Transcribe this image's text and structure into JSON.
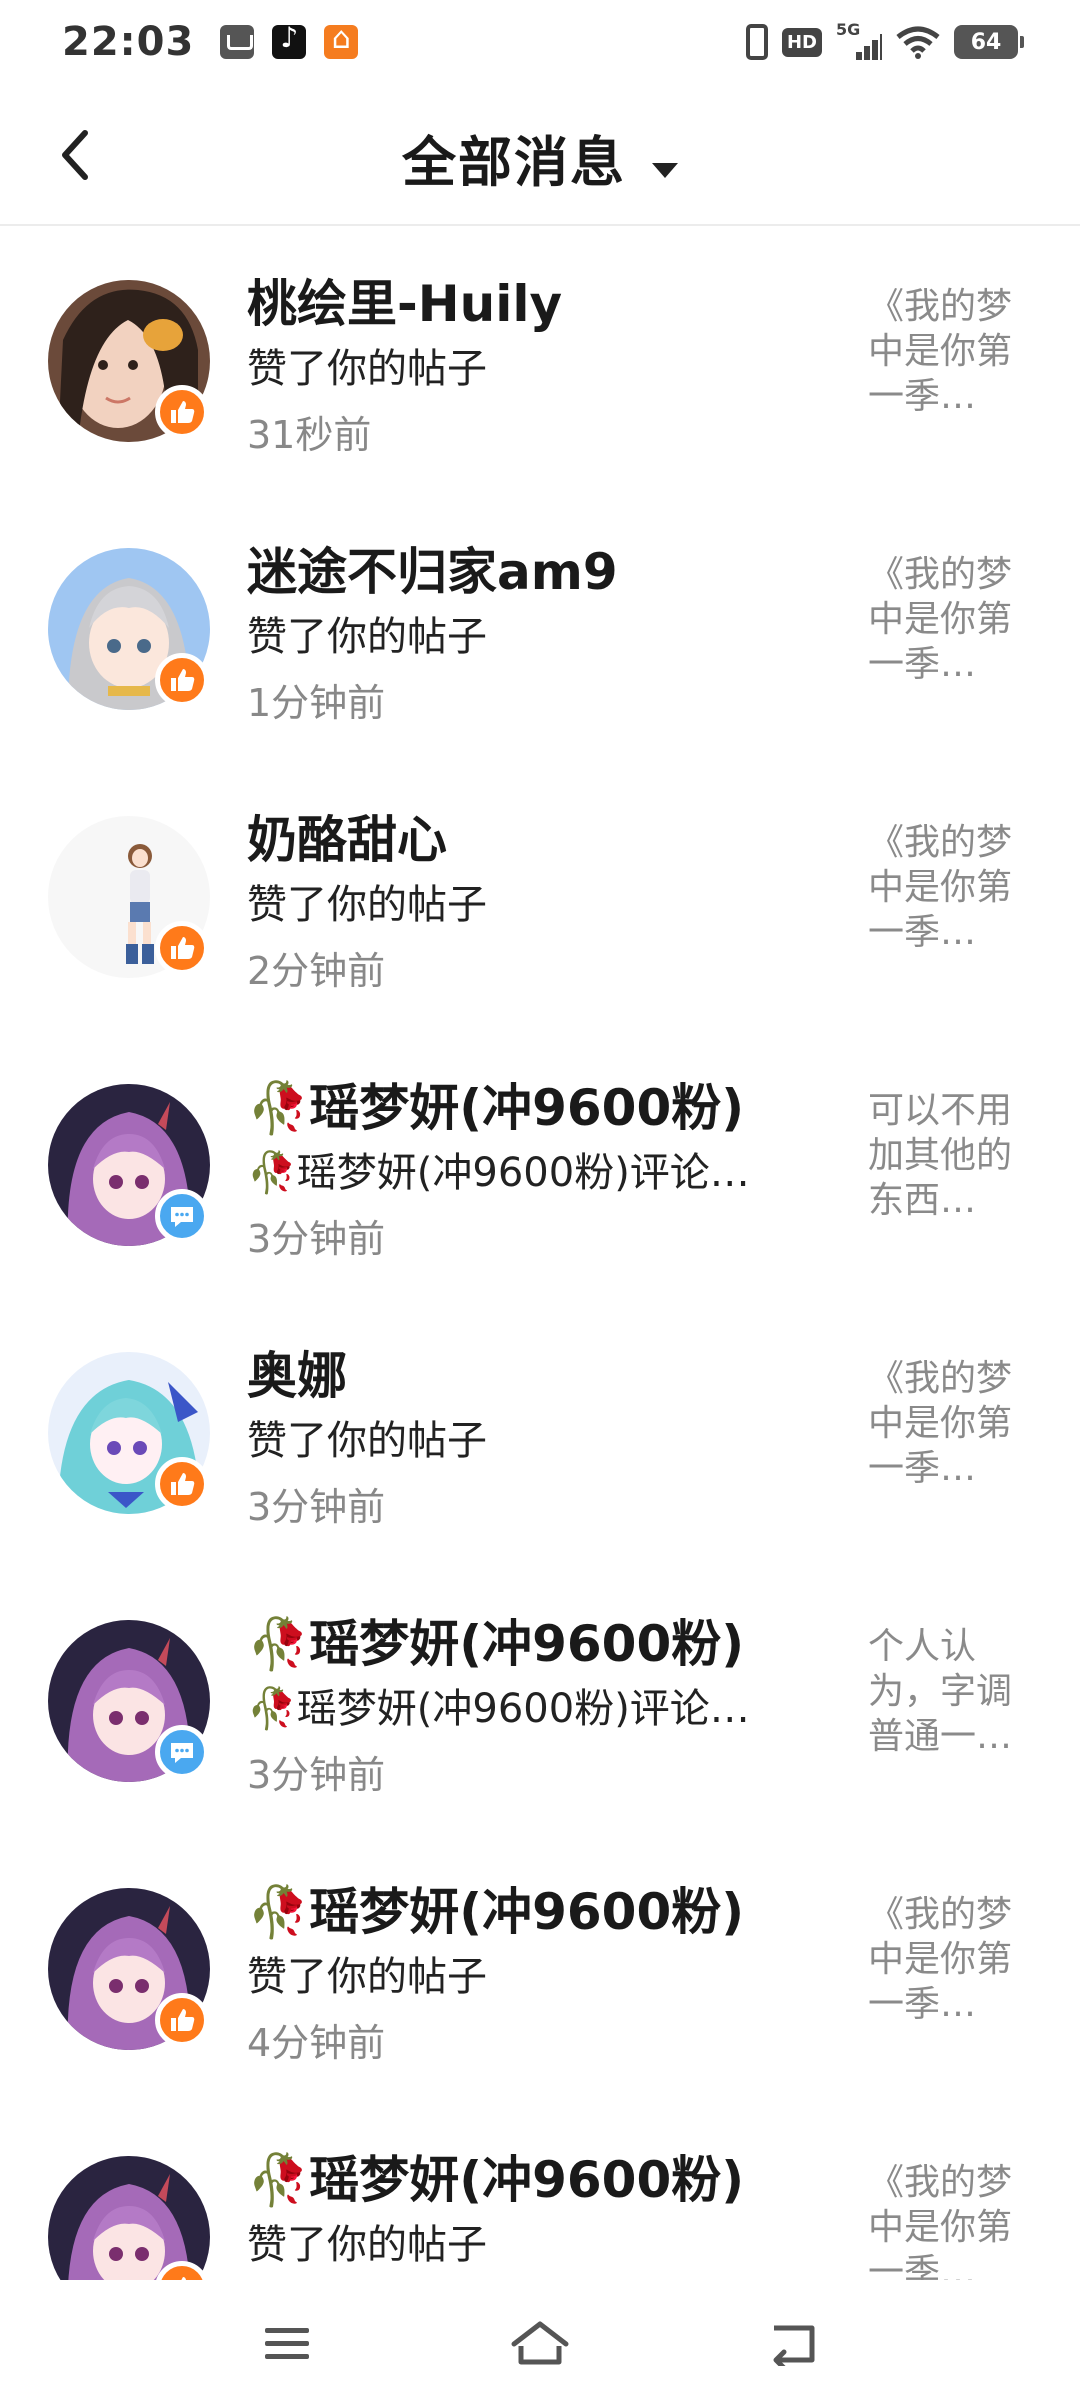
{
  "status_bar": {
    "time": "22:03",
    "network": "5G",
    "hd": "HD",
    "battery": "64"
  },
  "header": {
    "title": "全部消息"
  },
  "messages": [
    {
      "name": "桃绘里-Huily",
      "action": "赞了你的帖子",
      "time": "31秒前",
      "preview": "《我的梦中是你第一季…",
      "type": "like"
    },
    {
      "name": "迷途不归家am9",
      "action": "赞了你的帖子",
      "time": "1分钟前",
      "preview": "《我的梦中是你第一季…",
      "type": "like"
    },
    {
      "name": "奶酪甜心",
      "action": "赞了你的帖子",
      "time": "2分钟前",
      "preview": "《我的梦中是你第一季…",
      "type": "like"
    },
    {
      "name": "🥀瑶梦妍(冲9600粉)",
      "action": "🥀瑶梦妍(冲9600粉)评论…",
      "time": "3分钟前",
      "preview": "可以不用加其他的东西…",
      "type": "comment"
    },
    {
      "name": "奥娜",
      "action": "赞了你的帖子",
      "time": "3分钟前",
      "preview": "《我的梦中是你第一季…",
      "type": "like"
    },
    {
      "name": "🥀瑶梦妍(冲9600粉)",
      "action": "🥀瑶梦妍(冲9600粉)评论…",
      "time": "3分钟前",
      "preview": "个人认为，字调普通一…",
      "type": "comment"
    },
    {
      "name": "🥀瑶梦妍(冲9600粉)",
      "action": "赞了你的帖子",
      "time": "4分钟前",
      "preview": "《我的梦中是你第一季…",
      "type": "like"
    },
    {
      "name": "🥀瑶梦妍(冲9600粉)",
      "action": "赞了你的帖子",
      "time": "",
      "preview": "《我的梦中是你第一季…",
      "type": "like"
    }
  ],
  "icons": {
    "back": "back-arrow-icon",
    "dropdown": "caret-down-icon",
    "like_badge": "thumbs-up-icon",
    "comment_badge": "chat-bubble-icon",
    "nav_menu": "menu-icon",
    "nav_home": "home-icon",
    "nav_back": "back-icon"
  },
  "colors": {
    "like_badge": "#ff7a1a",
    "comment_badge": "#4aa8f0",
    "text_secondary": "#888888"
  }
}
